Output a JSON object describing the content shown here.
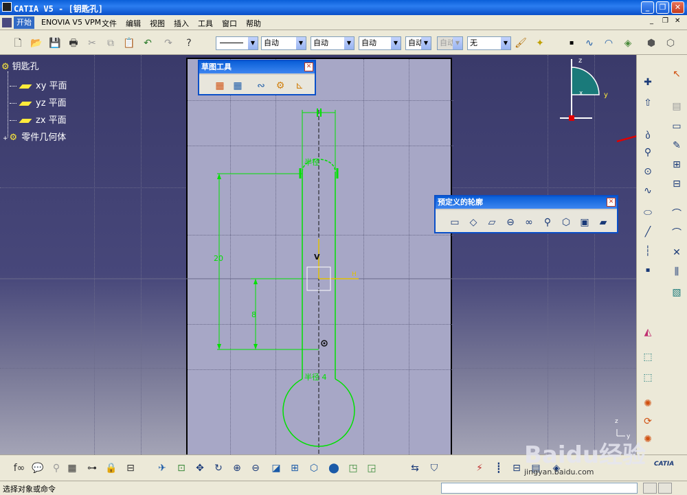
{
  "window": {
    "title": "CATIA V5 - [钥匙孔]"
  },
  "menu": [
    "开始",
    "ENOVIA V5 VPM",
    "文件",
    "编辑",
    "视图",
    "插入",
    "工具",
    "窗口",
    "帮助"
  ],
  "toolbar": {
    "combos": [
      "",
      "自动",
      "自动",
      "自动",
      "自动",
      "自动",
      "无"
    ]
  },
  "tree": {
    "root": "钥匙孔",
    "items": [
      "xy 平面",
      "yz 平面",
      "zx 平面",
      "零件几何体"
    ]
  },
  "panels": {
    "sketch_tools": {
      "title": "草图工具"
    },
    "predefined_profile": {
      "title": "预定义的轮廓"
    }
  },
  "sketch": {
    "dim_20": "20",
    "dim_8": "8",
    "label_top_radius": "半径",
    "label_bottom_radius": "半径 4",
    "axis_v": "V",
    "axis_h": "H"
  },
  "compass": {
    "z": "z",
    "y": "y",
    "x": "x"
  },
  "status": {
    "text": "选择对象或命令"
  },
  "watermark": {
    "text": "Baidu经验",
    "url": "jingyan.baidu.com"
  },
  "brand": "CATIA",
  "colors": {
    "sketch": "#00e000",
    "accent": "#0a4fc8",
    "selection": "#ffffff"
  }
}
